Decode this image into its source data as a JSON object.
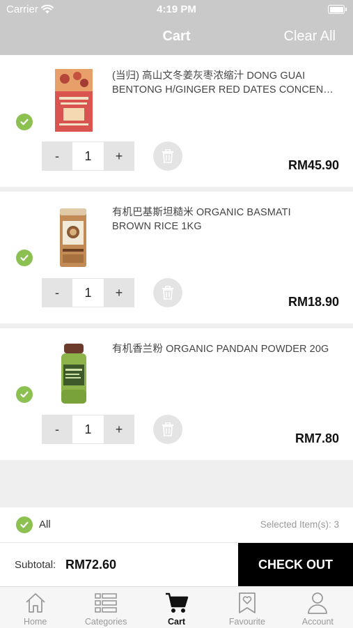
{
  "status_bar": {
    "carrier": "Carrier",
    "time": "4:19 PM"
  },
  "header": {
    "title": "Cart",
    "clear_all": "Clear All"
  },
  "items": [
    {
      "name_line1": "(当归) 高山文冬姜灰枣浓缩汁 DONG GUAI",
      "name_line2": "BENTONG H/GINGER RED DATES CONCENTRATE",
      "quantity": "1",
      "price": "RM45.90",
      "selected": true
    },
    {
      "name_line1": "有机巴基斯坦糙米 ORGANIC BASMATI",
      "name_line2": "BROWN RICE 1KG",
      "quantity": "1",
      "price": "RM18.90",
      "selected": true
    },
    {
      "name_line1": "有机香兰粉 ORGANIC PANDAN POWDER 20G",
      "name_line2": "",
      "quantity": "1",
      "price": "RM7.80",
      "selected": true
    }
  ],
  "qty_controls": {
    "minus": "-",
    "plus": "+"
  },
  "select_all": {
    "label": "All",
    "selected_text": "Selected Item(s):  3"
  },
  "summary": {
    "subtotal_label": "Subtotal:",
    "subtotal_value": "RM72.60",
    "checkout_label": "CHECK OUT"
  },
  "tabs": [
    {
      "label": "Home",
      "icon": "home-icon"
    },
    {
      "label": "Categories",
      "icon": "categories-icon"
    },
    {
      "label": "Cart",
      "icon": "cart-icon",
      "active": true
    },
    {
      "label": "Favourite",
      "icon": "favourite-icon"
    },
    {
      "label": "Account",
      "icon": "account-icon"
    }
  ],
  "colors": {
    "accent_green": "#8cc152",
    "header_gray": "#c9c9c9",
    "checkout_black": "#000000"
  }
}
